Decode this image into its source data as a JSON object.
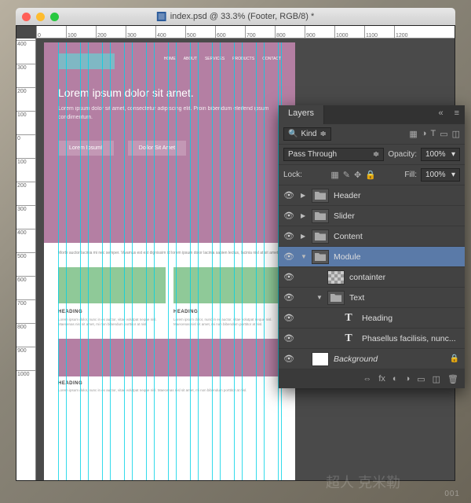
{
  "window": {
    "title": "index.psd @ 33.3% (Footer, RGB/8) *"
  },
  "rulers": {
    "top": [
      "0",
      "100",
      "200",
      "300",
      "400",
      "500",
      "600",
      "700",
      "800",
      "900",
      "1000",
      "1100",
      "1200"
    ],
    "left": [
      "400",
      "300",
      "200",
      "100",
      "0",
      "100",
      "200",
      "300",
      "400",
      "500",
      "600",
      "700",
      "800",
      "900",
      "1000"
    ]
  },
  "design": {
    "nav": [
      "HOME",
      "ABOUT",
      "SERVICES",
      "PRODUCTS",
      "CONTACT"
    ],
    "h1": "Lorem ipsum dolor sit amet.",
    "hp": "Lorem ipsum dolor sit amet, consectetur adipiscing elit. Proin bibendum eleifend ipsum condimentum.",
    "b1": "Lorem Ipsum!",
    "b2": "Dollor Sit Amet",
    "intro": "Morbi auctor lacinia mi nec semper. Vivamus est est dignissim id lorem ipsum dolor lacinia sapien lectus, lacinia nisl at sit amet.",
    "card_h": "HEADING",
    "card_p": "Lorem ipsum dolor, nunc in ex auctor, vitae volutpat neque nisl. Maecenas nisl sit amet, mi non bibendum porttitor at nisl."
  },
  "layers_panel": {
    "title": "Layers",
    "filter": "Kind",
    "blend": "Pass Through",
    "opacity_l": "Opacity:",
    "opacity_v": "100%",
    "lock_l": "Lock:",
    "fill_l": "Fill:",
    "fill_v": "100%",
    "items": [
      {
        "type": "folder",
        "name": "Header",
        "open": false
      },
      {
        "type": "folder",
        "name": "Slider",
        "open": false
      },
      {
        "type": "folder",
        "name": "Content",
        "open": false
      },
      {
        "type": "folder",
        "name": "Module",
        "open": true,
        "selected": true
      },
      {
        "type": "image",
        "name": "containter",
        "indent": 1
      },
      {
        "type": "folder",
        "name": "Text",
        "open": true,
        "indent": 1
      },
      {
        "type": "text",
        "name": "Heading",
        "indent": 2
      },
      {
        "type": "text",
        "name": "Phasellus facilisis, nunc...",
        "indent": 2
      },
      {
        "type": "bg",
        "name": "Background",
        "locked": true,
        "italic": true
      }
    ]
  },
  "search_placeholder": "Kind"
}
